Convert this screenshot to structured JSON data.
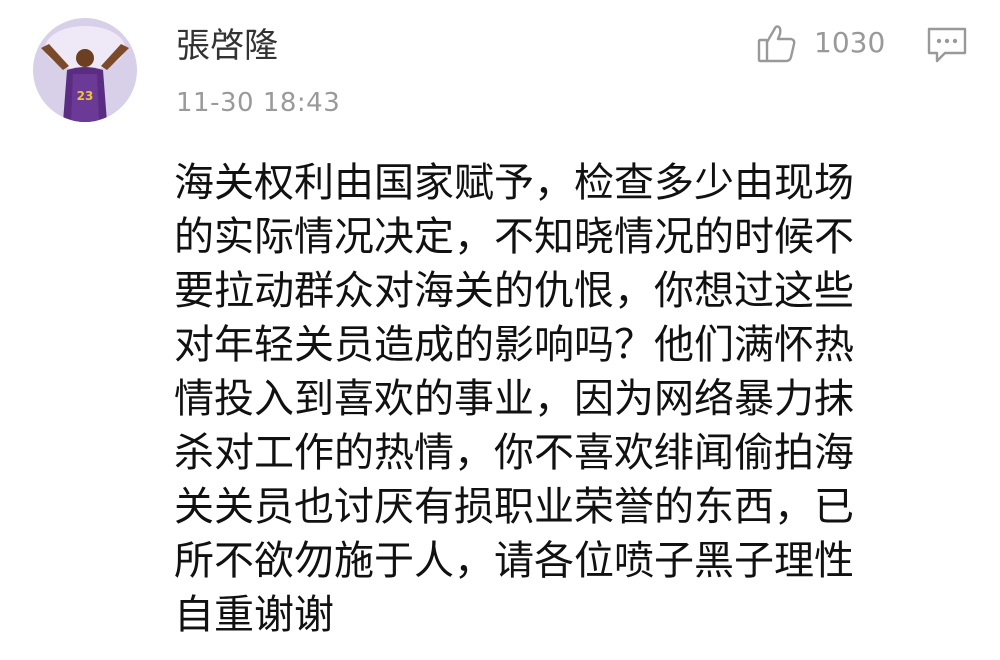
{
  "comment": {
    "username": "張啓隆",
    "timestamp": "11-30 18:43",
    "like_count": "1030",
    "avatar_jersey_number": "23",
    "body_lines": [
      "海关权利由国家赋予，检查多少由现场",
      "的实际情况决定，不知晓情况的时候不",
      "要拉动群众对海关的仇恨，你想过这些",
      "对年轻关员造成的影响吗？他们满怀热",
      "情投入到喜欢的事业，因为网络暴力抹",
      "杀对工作的热情，你不喜欢绯闻偷拍海",
      "关关员也讨厌有损职业荣誉的东西，已",
      "所不欲勿施于人，请各位喷子黑子理性",
      "自重谢谢"
    ]
  },
  "icons": {
    "like": "thumbs-up-icon",
    "reply": "comment-bubble-icon"
  },
  "colors": {
    "username": "#333333",
    "meta": "#9a9a9a",
    "body_text": "#111111",
    "avatar_bg": "#d8cfe8",
    "jersey": "#5a2d82"
  }
}
